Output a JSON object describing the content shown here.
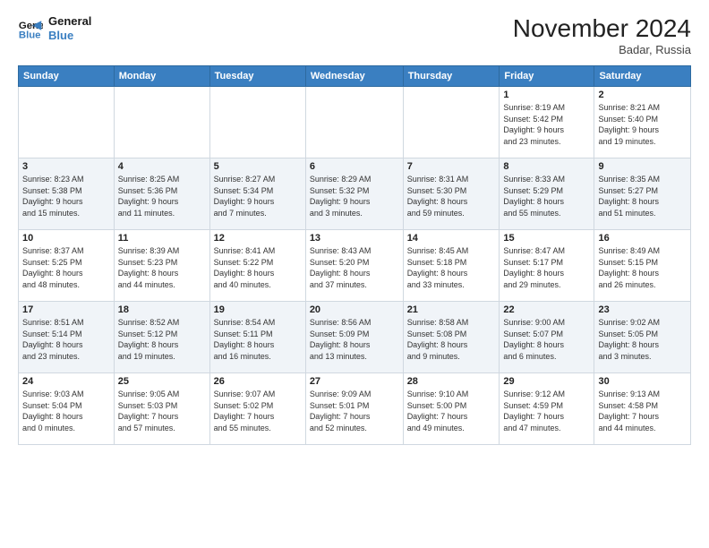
{
  "header": {
    "logo_line1": "General",
    "logo_line2": "Blue",
    "month_title": "November 2024",
    "location": "Badar, Russia"
  },
  "weekdays": [
    "Sunday",
    "Monday",
    "Tuesday",
    "Wednesday",
    "Thursday",
    "Friday",
    "Saturday"
  ],
  "weeks": [
    [
      {
        "day": "",
        "info": ""
      },
      {
        "day": "",
        "info": ""
      },
      {
        "day": "",
        "info": ""
      },
      {
        "day": "",
        "info": ""
      },
      {
        "day": "",
        "info": ""
      },
      {
        "day": "1",
        "info": "Sunrise: 8:19 AM\nSunset: 5:42 PM\nDaylight: 9 hours\nand 23 minutes."
      },
      {
        "day": "2",
        "info": "Sunrise: 8:21 AM\nSunset: 5:40 PM\nDaylight: 9 hours\nand 19 minutes."
      }
    ],
    [
      {
        "day": "3",
        "info": "Sunrise: 8:23 AM\nSunset: 5:38 PM\nDaylight: 9 hours\nand 15 minutes."
      },
      {
        "day": "4",
        "info": "Sunrise: 8:25 AM\nSunset: 5:36 PM\nDaylight: 9 hours\nand 11 minutes."
      },
      {
        "day": "5",
        "info": "Sunrise: 8:27 AM\nSunset: 5:34 PM\nDaylight: 9 hours\nand 7 minutes."
      },
      {
        "day": "6",
        "info": "Sunrise: 8:29 AM\nSunset: 5:32 PM\nDaylight: 9 hours\nand 3 minutes."
      },
      {
        "day": "7",
        "info": "Sunrise: 8:31 AM\nSunset: 5:30 PM\nDaylight: 8 hours\nand 59 minutes."
      },
      {
        "day": "8",
        "info": "Sunrise: 8:33 AM\nSunset: 5:29 PM\nDaylight: 8 hours\nand 55 minutes."
      },
      {
        "day": "9",
        "info": "Sunrise: 8:35 AM\nSunset: 5:27 PM\nDaylight: 8 hours\nand 51 minutes."
      }
    ],
    [
      {
        "day": "10",
        "info": "Sunrise: 8:37 AM\nSunset: 5:25 PM\nDaylight: 8 hours\nand 48 minutes."
      },
      {
        "day": "11",
        "info": "Sunrise: 8:39 AM\nSunset: 5:23 PM\nDaylight: 8 hours\nand 44 minutes."
      },
      {
        "day": "12",
        "info": "Sunrise: 8:41 AM\nSunset: 5:22 PM\nDaylight: 8 hours\nand 40 minutes."
      },
      {
        "day": "13",
        "info": "Sunrise: 8:43 AM\nSunset: 5:20 PM\nDaylight: 8 hours\nand 37 minutes."
      },
      {
        "day": "14",
        "info": "Sunrise: 8:45 AM\nSunset: 5:18 PM\nDaylight: 8 hours\nand 33 minutes."
      },
      {
        "day": "15",
        "info": "Sunrise: 8:47 AM\nSunset: 5:17 PM\nDaylight: 8 hours\nand 29 minutes."
      },
      {
        "day": "16",
        "info": "Sunrise: 8:49 AM\nSunset: 5:15 PM\nDaylight: 8 hours\nand 26 minutes."
      }
    ],
    [
      {
        "day": "17",
        "info": "Sunrise: 8:51 AM\nSunset: 5:14 PM\nDaylight: 8 hours\nand 23 minutes."
      },
      {
        "day": "18",
        "info": "Sunrise: 8:52 AM\nSunset: 5:12 PM\nDaylight: 8 hours\nand 19 minutes."
      },
      {
        "day": "19",
        "info": "Sunrise: 8:54 AM\nSunset: 5:11 PM\nDaylight: 8 hours\nand 16 minutes."
      },
      {
        "day": "20",
        "info": "Sunrise: 8:56 AM\nSunset: 5:09 PM\nDaylight: 8 hours\nand 13 minutes."
      },
      {
        "day": "21",
        "info": "Sunrise: 8:58 AM\nSunset: 5:08 PM\nDaylight: 8 hours\nand 9 minutes."
      },
      {
        "day": "22",
        "info": "Sunrise: 9:00 AM\nSunset: 5:07 PM\nDaylight: 8 hours\nand 6 minutes."
      },
      {
        "day": "23",
        "info": "Sunrise: 9:02 AM\nSunset: 5:05 PM\nDaylight: 8 hours\nand 3 minutes."
      }
    ],
    [
      {
        "day": "24",
        "info": "Sunrise: 9:03 AM\nSunset: 5:04 PM\nDaylight: 8 hours\nand 0 minutes."
      },
      {
        "day": "25",
        "info": "Sunrise: 9:05 AM\nSunset: 5:03 PM\nDaylight: 7 hours\nand 57 minutes."
      },
      {
        "day": "26",
        "info": "Sunrise: 9:07 AM\nSunset: 5:02 PM\nDaylight: 7 hours\nand 55 minutes."
      },
      {
        "day": "27",
        "info": "Sunrise: 9:09 AM\nSunset: 5:01 PM\nDaylight: 7 hours\nand 52 minutes."
      },
      {
        "day": "28",
        "info": "Sunrise: 9:10 AM\nSunset: 5:00 PM\nDaylight: 7 hours\nand 49 minutes."
      },
      {
        "day": "29",
        "info": "Sunrise: 9:12 AM\nSunset: 4:59 PM\nDaylight: 7 hours\nand 47 minutes."
      },
      {
        "day": "30",
        "info": "Sunrise: 9:13 AM\nSunset: 4:58 PM\nDaylight: 7 hours\nand 44 minutes."
      }
    ]
  ]
}
